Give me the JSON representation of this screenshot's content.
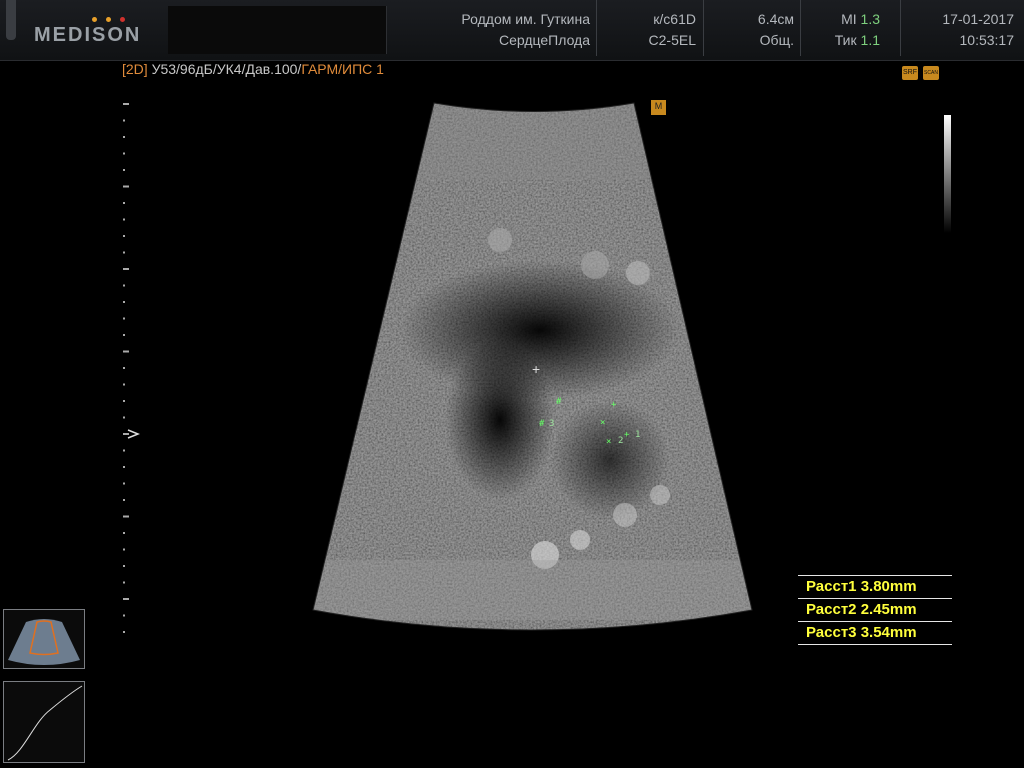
{
  "header": {
    "brand": "MEDISON",
    "hospital": "Роддом им. Гуткина",
    "exam": "СердцеПлода",
    "probe_preset": "к/с61D",
    "probe": "C2-5EL",
    "depth": "6.4см",
    "app": "Общ.",
    "mi_label": "MI",
    "mi_value": "1.3",
    "tib_label": "Тик",
    "tib_value": "1.1",
    "date": "17-01-2017",
    "time": "10:53:17"
  },
  "mode_line": {
    "mode": "[2D]",
    "params": " У53/96дБ/УК4/Дав.100/",
    "harm": "ГАРМ/ИПС 1"
  },
  "icons": {
    "srf": "SRF",
    "scan": "SCAN",
    "marker": "M"
  },
  "calipers": {
    "m1": "1",
    "m2": "2",
    "m3": "3"
  },
  "measurements": [
    {
      "label": "Расст1",
      "value": "3.80mm"
    },
    {
      "label": "Расст2",
      "value": "2.45mm"
    },
    {
      "label": "Расст3",
      "value": "3.54mm"
    }
  ],
  "colors": {
    "accent_green": "#7ed07e",
    "measure_yellow": "#ffff3c",
    "orange": "#e08b3a"
  }
}
